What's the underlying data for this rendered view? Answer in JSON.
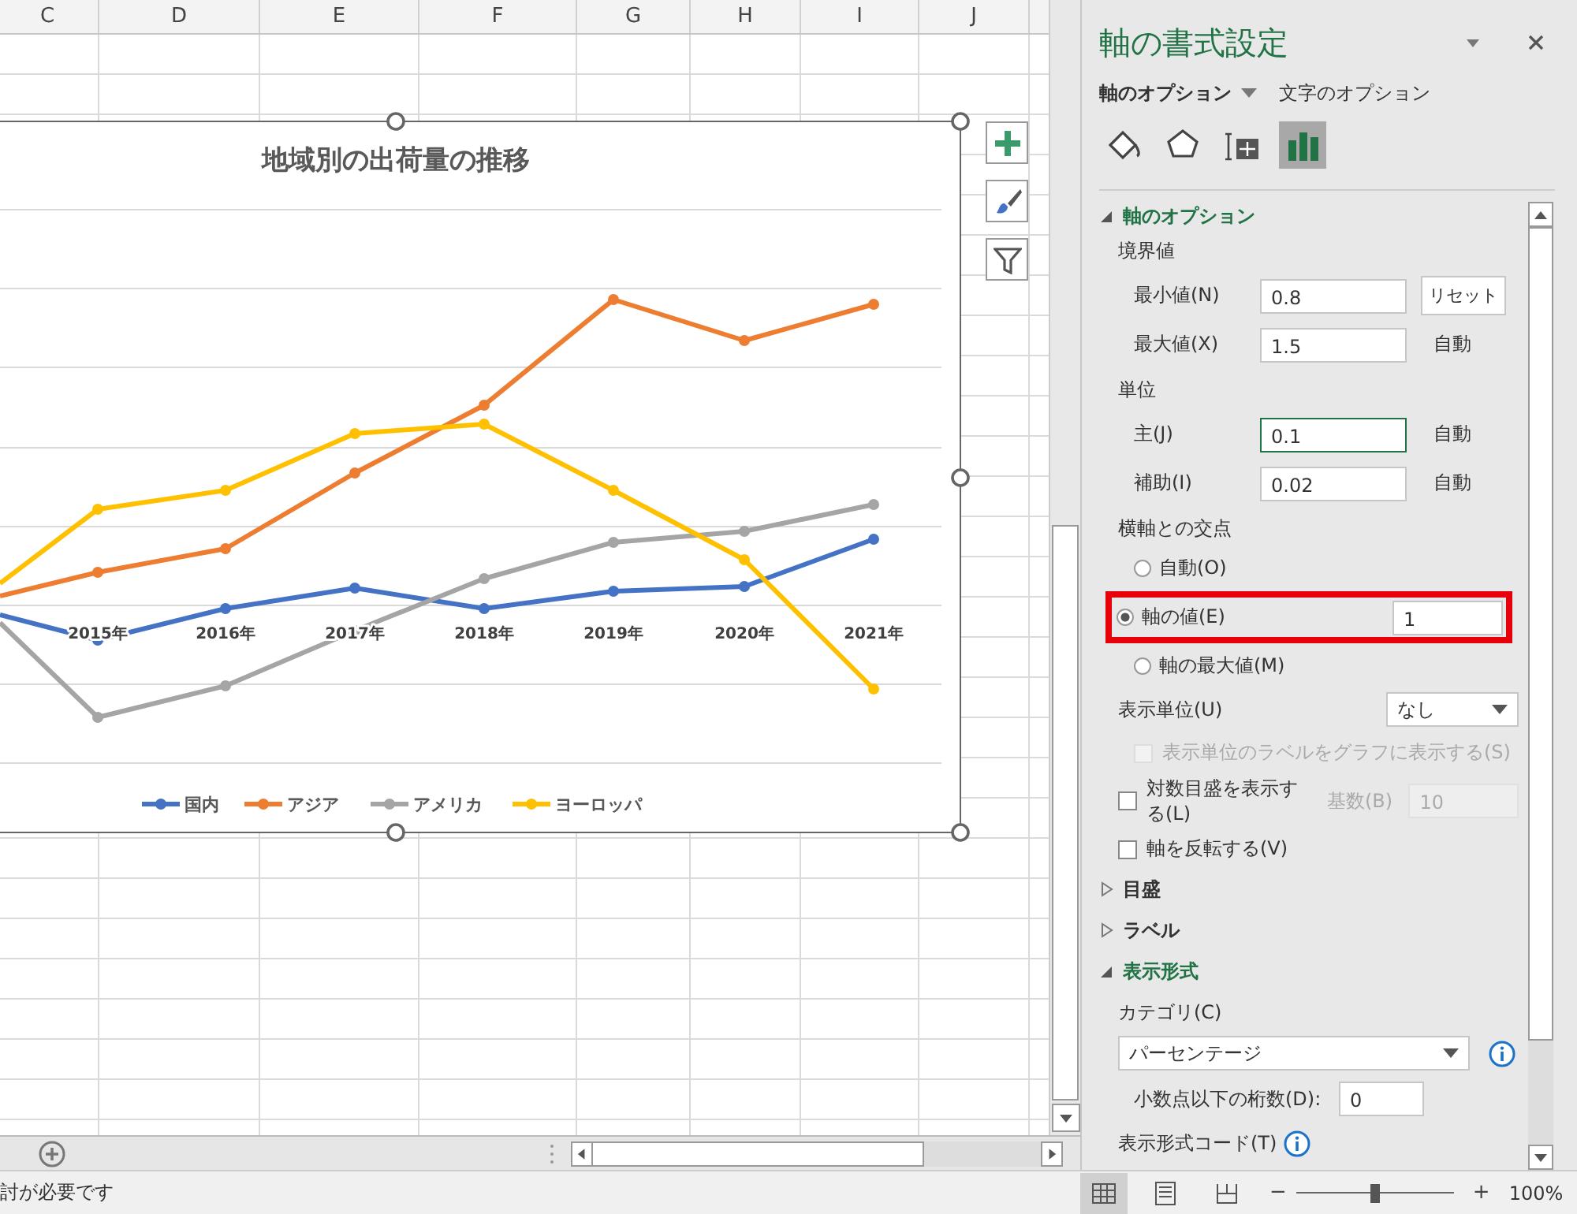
{
  "sheet": {
    "columns": [
      "C",
      "D",
      "E",
      "F",
      "G",
      "H",
      "I",
      "J"
    ]
  },
  "chart": {
    "title": "地域別の出荷量の推移",
    "categories": [
      "2015年",
      "2016年",
      "2017年",
      "2018年",
      "2019年",
      "2020年",
      "2021年"
    ],
    "series": [
      {
        "name": "国内",
        "color": "#4472c4"
      },
      {
        "name": "アジア",
        "color": "#ed7d31"
      },
      {
        "name": "アメリカ",
        "color": "#a5a5a5"
      },
      {
        "name": "ヨーロッパ",
        "color": "#ffc000"
      }
    ]
  },
  "panel": {
    "title": "軸の書式設定",
    "tabs": [
      {
        "label": "軸のオプション",
        "selected": true
      },
      {
        "label": "文字のオプション",
        "selected": false
      }
    ],
    "icon_tabs": [
      {
        "kind": "fill",
        "selected": false
      },
      {
        "kind": "effects",
        "selected": false
      },
      {
        "kind": "size",
        "selected": false
      },
      {
        "kind": "options",
        "selected": true
      }
    ],
    "section": {
      "title": "軸のオプション",
      "expanded": true
    },
    "bounds": {
      "label": "境界値",
      "rows": [
        {
          "label": "最小値(N)",
          "value": "0.8",
          "action": "リセット",
          "kind": "button",
          "focused": false
        },
        {
          "label": "最大値(X)",
          "value": "1.5",
          "action": "自動",
          "kind": "text",
          "focused": false
        }
      ]
    },
    "units": {
      "label": "単位",
      "rows": [
        {
          "label": "主(J)",
          "value": "0.1",
          "action": "自動",
          "kind": "text",
          "focused": true
        },
        {
          "label": "補助(I)",
          "value": "0.02",
          "action": "自動",
          "kind": "text",
          "focused": false
        }
      ]
    },
    "crosses": {
      "label": "横軸との交点",
      "options": [
        {
          "label": "自動(O)",
          "selected": false,
          "highlighted": false
        },
        {
          "label": "軸の値(E)",
          "selected": true,
          "highlighted": true,
          "value": "1"
        },
        {
          "label": "軸の最大値(M)",
          "selected": false,
          "highlighted": false
        }
      ]
    },
    "display_units": {
      "label": "表示単位(U)",
      "value": "なし"
    },
    "checks": [
      {
        "label": "表示単位のラベルをグラフに表示する(S)",
        "checked": false,
        "disabled": true
      },
      {
        "label": "対数目盛を表示する(L)",
        "checked": false,
        "disabled": false,
        "base_label": "基数(B)",
        "base_value": "10"
      },
      {
        "label": "軸を反転する(V)",
        "checked": false,
        "disabled": false
      }
    ],
    "collapsed_sections": [
      {
        "title": "目盛",
        "expanded": false
      },
      {
        "title": "ラベル",
        "expanded": false
      }
    ],
    "number_section": {
      "title": "表示形式",
      "expanded": true,
      "category_label": "カテゴリ(C)",
      "category_value": "パーセンテージ",
      "decimals_label": "小数点以下の桁数(D):",
      "decimals_value": "0",
      "code_label": "表示形式コード(T)"
    }
  },
  "status_bar": {
    "message": "討が必要です",
    "views": [
      {
        "kind": "normal",
        "selected": true
      },
      {
        "kind": "page-layout",
        "selected": false
      },
      {
        "kind": "page-break",
        "selected": false
      }
    ],
    "zoom_minus": "−",
    "zoom_plus": "+",
    "zoom": {
      "level": 0.5
    },
    "zoom_text": "100%"
  }
}
